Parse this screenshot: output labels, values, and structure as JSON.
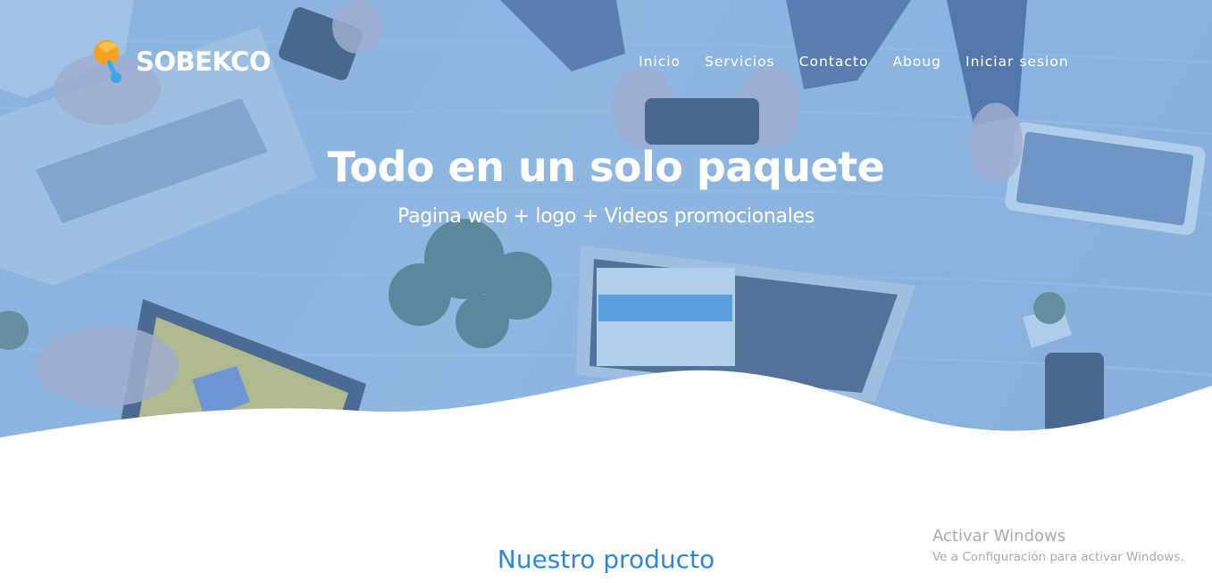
{
  "brand": {
    "name": "SOBEKCO",
    "accent_orange": "#f4a21f",
    "accent_blue": "#3aa7e6"
  },
  "nav": {
    "items": [
      {
        "label": "Inicio"
      },
      {
        "label": "Servicios"
      },
      {
        "label": "Contacto"
      },
      {
        "label": "Aboug"
      },
      {
        "label": "Iniciar sesion"
      }
    ]
  },
  "hero": {
    "title": "Todo en un solo paquete",
    "subtitle": "Pagina web + logo + Videos promocionales",
    "overlay_color": "#6ea3d9"
  },
  "section": {
    "title": "Nuestro producto",
    "title_color": "#2e86d9"
  },
  "watermark": {
    "title": "Activar Windows",
    "subtitle": "Ve a Configuración para activar Windows."
  }
}
